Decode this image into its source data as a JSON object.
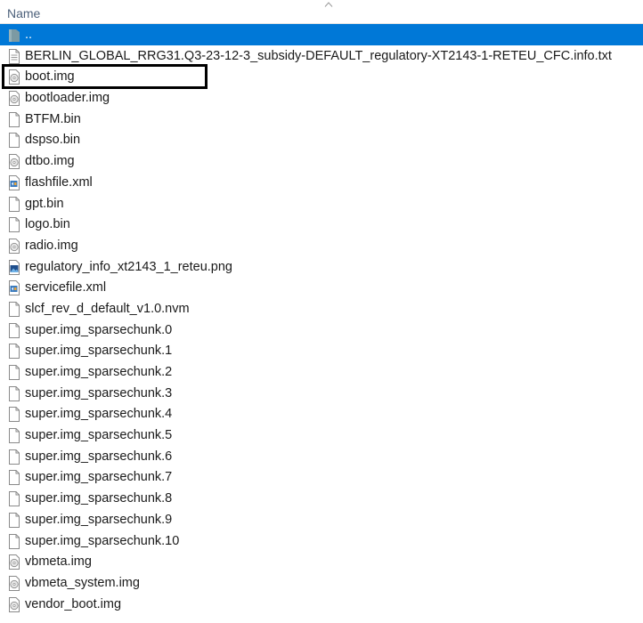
{
  "header": {
    "name_label": "Name",
    "sort": "ascending"
  },
  "colors": {
    "selection": "#0078d7",
    "highlight_box": "#000000"
  },
  "files": [
    {
      "name": "..",
      "icon": "parent-folder-icon",
      "selected": true
    },
    {
      "name": "BERLIN_GLOBAL_RRG31.Q3-23-12-3_subsidy-DEFAULT_regulatory-XT2143-1-RETEU_CFC.info.txt",
      "icon": "text-file-icon"
    },
    {
      "name": "boot.img",
      "icon": "disc-image-icon",
      "highlighted": true
    },
    {
      "name": "bootloader.img",
      "icon": "disc-image-icon"
    },
    {
      "name": "BTFM.bin",
      "icon": "file-icon"
    },
    {
      "name": "dspso.bin",
      "icon": "file-icon"
    },
    {
      "name": "dtbo.img",
      "icon": "disc-image-icon"
    },
    {
      "name": "flashfile.xml",
      "icon": "xml-file-icon"
    },
    {
      "name": "gpt.bin",
      "icon": "file-icon"
    },
    {
      "name": "logo.bin",
      "icon": "file-icon"
    },
    {
      "name": "radio.img",
      "icon": "disc-image-icon"
    },
    {
      "name": "regulatory_info_xt2143_1_reteu.png",
      "icon": "image-file-icon"
    },
    {
      "name": "servicefile.xml",
      "icon": "xml-file-icon"
    },
    {
      "name": "slcf_rev_d_default_v1.0.nvm",
      "icon": "file-icon"
    },
    {
      "name": "super.img_sparsechunk.0",
      "icon": "file-icon"
    },
    {
      "name": "super.img_sparsechunk.1",
      "icon": "file-icon"
    },
    {
      "name": "super.img_sparsechunk.2",
      "icon": "file-icon"
    },
    {
      "name": "super.img_sparsechunk.3",
      "icon": "file-icon"
    },
    {
      "name": "super.img_sparsechunk.4",
      "icon": "file-icon"
    },
    {
      "name": "super.img_sparsechunk.5",
      "icon": "file-icon"
    },
    {
      "name": "super.img_sparsechunk.6",
      "icon": "file-icon"
    },
    {
      "name": "super.img_sparsechunk.7",
      "icon": "file-icon"
    },
    {
      "name": "super.img_sparsechunk.8",
      "icon": "file-icon"
    },
    {
      "name": "super.img_sparsechunk.9",
      "icon": "file-icon"
    },
    {
      "name": "super.img_sparsechunk.10",
      "icon": "file-icon"
    },
    {
      "name": "vbmeta.img",
      "icon": "disc-image-icon"
    },
    {
      "name": "vbmeta_system.img",
      "icon": "disc-image-icon"
    },
    {
      "name": "vendor_boot.img",
      "icon": "disc-image-icon"
    }
  ]
}
